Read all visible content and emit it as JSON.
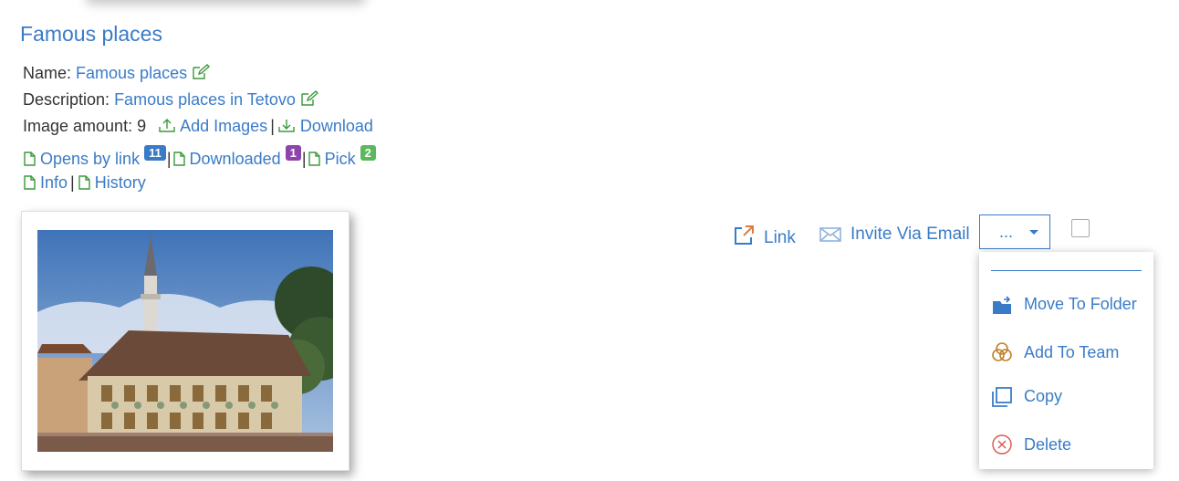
{
  "album": {
    "title": "Famous places",
    "name_label": "Name:",
    "name_value": "Famous places",
    "description_label": "Description:",
    "description_value": "Famous places in Tetovo",
    "amount_label": "Image amount: 9",
    "add_images": "Add Images",
    "download": "Download"
  },
  "stats": {
    "opens_by_link": "Opens by link",
    "opens_count": "11",
    "downloaded": "Downloaded",
    "downloaded_count": "1",
    "pick": "Pick",
    "pick_count": "2",
    "info": "Info",
    "history": "History",
    "separator": "|"
  },
  "actions": {
    "link": "Link",
    "invite_email": "Invite Via Email",
    "more": "..."
  },
  "dropdown": {
    "items": [
      {
        "label": "Move To Folder",
        "icon": "move-folder-icon"
      },
      {
        "label": "Add To Team",
        "icon": "team-icon"
      },
      {
        "label": "Copy",
        "icon": "copy-icon"
      },
      {
        "label": "Delete",
        "icon": "delete-icon"
      }
    ]
  },
  "colors": {
    "link": "#3a7bc8",
    "green_icon": "#3a9a3a",
    "badge_blue": "#3a7bc8",
    "badge_purple": "#8e44ad",
    "badge_green": "#5cb85c",
    "link_icon_orange": "#e07b39",
    "delete_red": "#d9534f"
  }
}
